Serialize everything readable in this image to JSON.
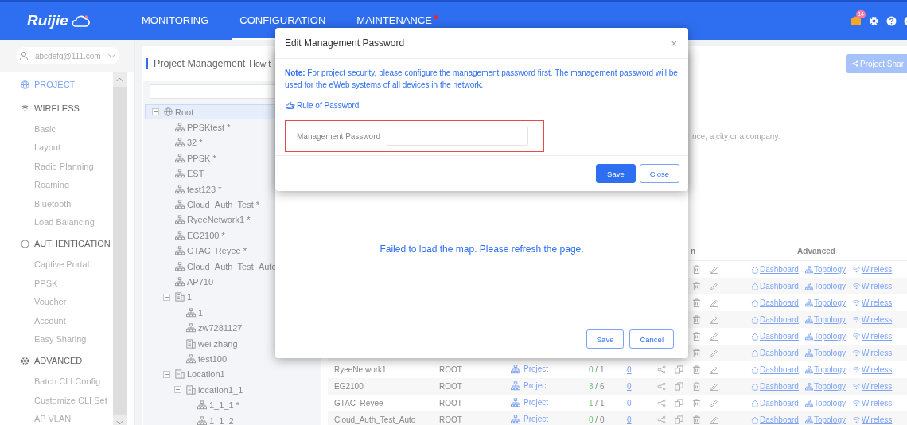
{
  "header": {
    "logo": "Ruijie",
    "nav": [
      {
        "label": "MONITORING",
        "selected": false,
        "alert": false
      },
      {
        "label": "CONFIGURATION",
        "selected": true,
        "alert": false
      },
      {
        "label": "MAINTENANCE",
        "selected": false,
        "alert": true
      }
    ],
    "notifications": "14"
  },
  "sidebar": {
    "account": "abcdefg@111.com",
    "sections": [
      {
        "label": "PROJECT",
        "kind": "project",
        "selected": true
      },
      {
        "label": "WIRELESS",
        "kind": "wireless",
        "selected": false,
        "items": [
          {
            "label": "Basic",
            "selected": false
          },
          {
            "label": "Layout",
            "selected": false
          },
          {
            "label": "Radio Planning",
            "selected": false
          },
          {
            "label": "Roaming",
            "selected": false
          },
          {
            "label": "Bluetooth",
            "selected": false
          },
          {
            "label": "Load Balancing",
            "selected": false
          }
        ]
      },
      {
        "label": "AUTHENTICATION",
        "kind": "authentication",
        "selected": false,
        "items": [
          {
            "label": "Captive Portal",
            "selected": false
          },
          {
            "label": "PPSK",
            "selected": false
          },
          {
            "label": "Voucher",
            "selected": false
          },
          {
            "label": "Account",
            "selected": false
          },
          {
            "label": "Easy Sharing",
            "selected": false
          }
        ]
      },
      {
        "label": "ADVANCED",
        "kind": "advanced",
        "selected": false,
        "items": [
          {
            "label": "Batch CLI Config",
            "selected": false
          },
          {
            "label": "Customize CLI Set",
            "selected": false
          },
          {
            "label": "AP VLAN",
            "selected": false
          }
        ]
      }
    ]
  },
  "project": {
    "title": "Project Management",
    "help_link": "How t",
    "share_button": "Project Shar",
    "hint": "nce, a city or a company.",
    "tree": [
      {
        "label": "Root",
        "kind": "root",
        "selected": true,
        "expanded": true,
        "children": [
          {
            "label": "PPSKtest *",
            "kind": "network",
            "selected": false
          },
          {
            "label": "32 *",
            "kind": "network",
            "selected": false
          },
          {
            "label": "PPSK *",
            "kind": "network",
            "selected": false
          },
          {
            "label": "EST",
            "kind": "network",
            "selected": false
          },
          {
            "label": "test123 *",
            "kind": "network",
            "selected": false
          },
          {
            "label": "Cloud_Auth_Test *",
            "kind": "network",
            "selected": false
          },
          {
            "label": "RyeeNetwork1 *",
            "kind": "network",
            "selected": false
          },
          {
            "label": "EG2100 *",
            "kind": "network",
            "selected": false
          },
          {
            "label": "GTAC_Reyee *",
            "kind": "network",
            "selected": false
          },
          {
            "label": "Cloud_Auth_Test_Auto",
            "kind": "network",
            "selected": false
          },
          {
            "label": "AP710",
            "kind": "network",
            "selected": false
          },
          {
            "label": "1",
            "kind": "building",
            "selected": false,
            "expanded": true,
            "children": [
              {
                "label": "1",
                "kind": "network",
                "selected": false
              },
              {
                "label": "zw7281127",
                "kind": "network",
                "selected": false
              },
              {
                "label": "wei zhang",
                "kind": "building",
                "selected": false
              },
              {
                "label": "test100",
                "kind": "network",
                "selected": false
              }
            ]
          },
          {
            "label": "Location1",
            "kind": "building",
            "selected": false,
            "expanded": true,
            "children": [
              {
                "label": "location1_1",
                "kind": "building",
                "selected": false,
                "expanded": true,
                "children": [
                  {
                    "label": "1_1_1 *",
                    "kind": "network",
                    "selected": false
                  },
                  {
                    "label": "1_1_2",
                    "kind": "network",
                    "selected": false
                  }
                ]
              }
            ]
          }
        ]
      }
    ]
  },
  "table": {
    "columns": [
      {
        "kind": "action",
        "label": "n"
      },
      {
        "kind": "advanced",
        "label": "Advanced"
      }
    ],
    "rows": [
      {
        "kind": "partial",
        "links": [
          "Dashboard",
          "Topology",
          "Wireless"
        ]
      },
      {
        "kind": "partial",
        "links": [
          "Dashboard",
          "Topology",
          "Wireless"
        ]
      },
      {
        "kind": "partial",
        "links": [
          "Dashboard",
          "Topology",
          "Wireless"
        ]
      },
      {
        "kind": "partial",
        "links": [
          "Dashboard",
          "Topology",
          "Wireless"
        ]
      },
      {
        "kind": "partial",
        "links": [
          "Dashboard",
          "Topology",
          "Wireless"
        ]
      },
      {
        "kind": "partial",
        "links": [
          "Dashboard",
          "Topology",
          "Wireless"
        ]
      },
      {
        "kind": "full",
        "name": "RyeeNetwork1",
        "parent": "ROOT",
        "project": "Project",
        "online": "0",
        "total": "/ 1",
        "alarms": "0",
        "links": [
          "Dashboard",
          "Topology",
          "Wireless"
        ]
      },
      {
        "kind": "full",
        "name": "EG2100",
        "parent": "ROOT",
        "project": "Project",
        "online": "3",
        "total": "/ 6",
        "alarms": "0",
        "links": [
          "Dashboard",
          "Topology",
          "Wireless"
        ]
      },
      {
        "kind": "full",
        "name": "GTAC_Reyee",
        "parent": "ROOT",
        "project": "Project",
        "online": "1",
        "total": "/ 1",
        "alarms": "0",
        "links": [
          "Dashboard",
          "Topology",
          "Wireless"
        ]
      },
      {
        "kind": "full",
        "name": "Cloud_Auth_Test_Auto",
        "parent": "ROOT",
        "project": "Project",
        "online": "0",
        "total": "/ 0",
        "alarms": "0",
        "links": [
          "Dashboard",
          "Topology",
          "Wireless"
        ]
      }
    ]
  },
  "map_dialog": {
    "message": "Failed to load the map. Please refresh the page.",
    "buttons": [
      "Save",
      "Cancel"
    ]
  },
  "password_dialog": {
    "title": "Edit Management Password",
    "close": "×",
    "note": "**Note:** For project security, please configure the management password first. The management password will be used for the eWeb systems of all devices in the network.",
    "rule_link": "Rule of Password",
    "field_label": "Management Password",
    "buttons": [
      "Save",
      "Close"
    ]
  }
}
